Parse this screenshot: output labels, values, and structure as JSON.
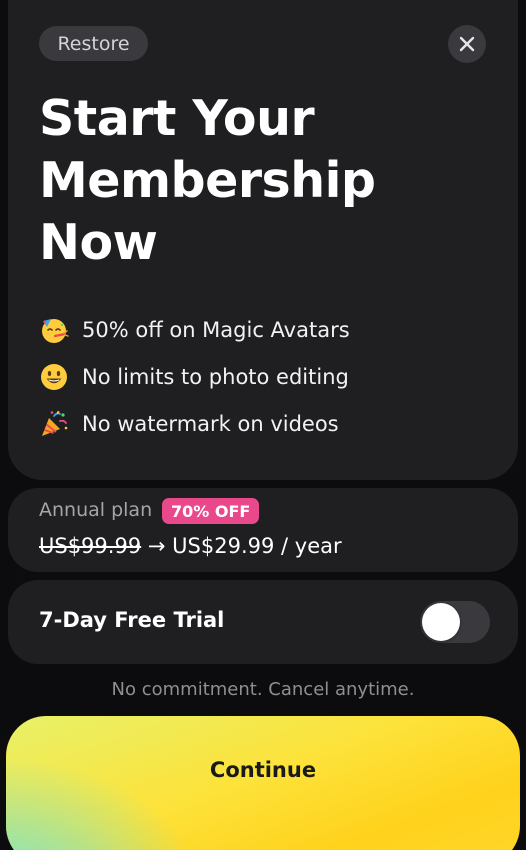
{
  "header": {
    "restore_label": "Restore",
    "close_icon": "close-icon"
  },
  "headline": {
    "line1": "Start Your",
    "line2": "Membership",
    "line3": "Now"
  },
  "features": [
    {
      "icon": "party-face-emoji-icon",
      "text": "50% off on Magic Avatars"
    },
    {
      "icon": "smiling-face-emoji-icon",
      "text": "No limits to photo editing"
    },
    {
      "icon": "party-popper-emoji-icon",
      "text": "No watermark on videos"
    }
  ],
  "plan": {
    "name": "Annual plan",
    "badge": "70% OFF",
    "old_price": "US$99.99",
    "arrow": "→",
    "new_price": "US$29.99 / year"
  },
  "trial": {
    "label": "7-Day Free Trial",
    "enabled": false
  },
  "commitment_text": "No commitment. Cancel anytime.",
  "cta": {
    "continue_label": "Continue"
  },
  "colors": {
    "background": "#0c0c0e",
    "card": "#1f1f22",
    "badge": "#e9498a",
    "cta_yellow": "#fde23a",
    "cta_teal": "#6fe3d8"
  }
}
